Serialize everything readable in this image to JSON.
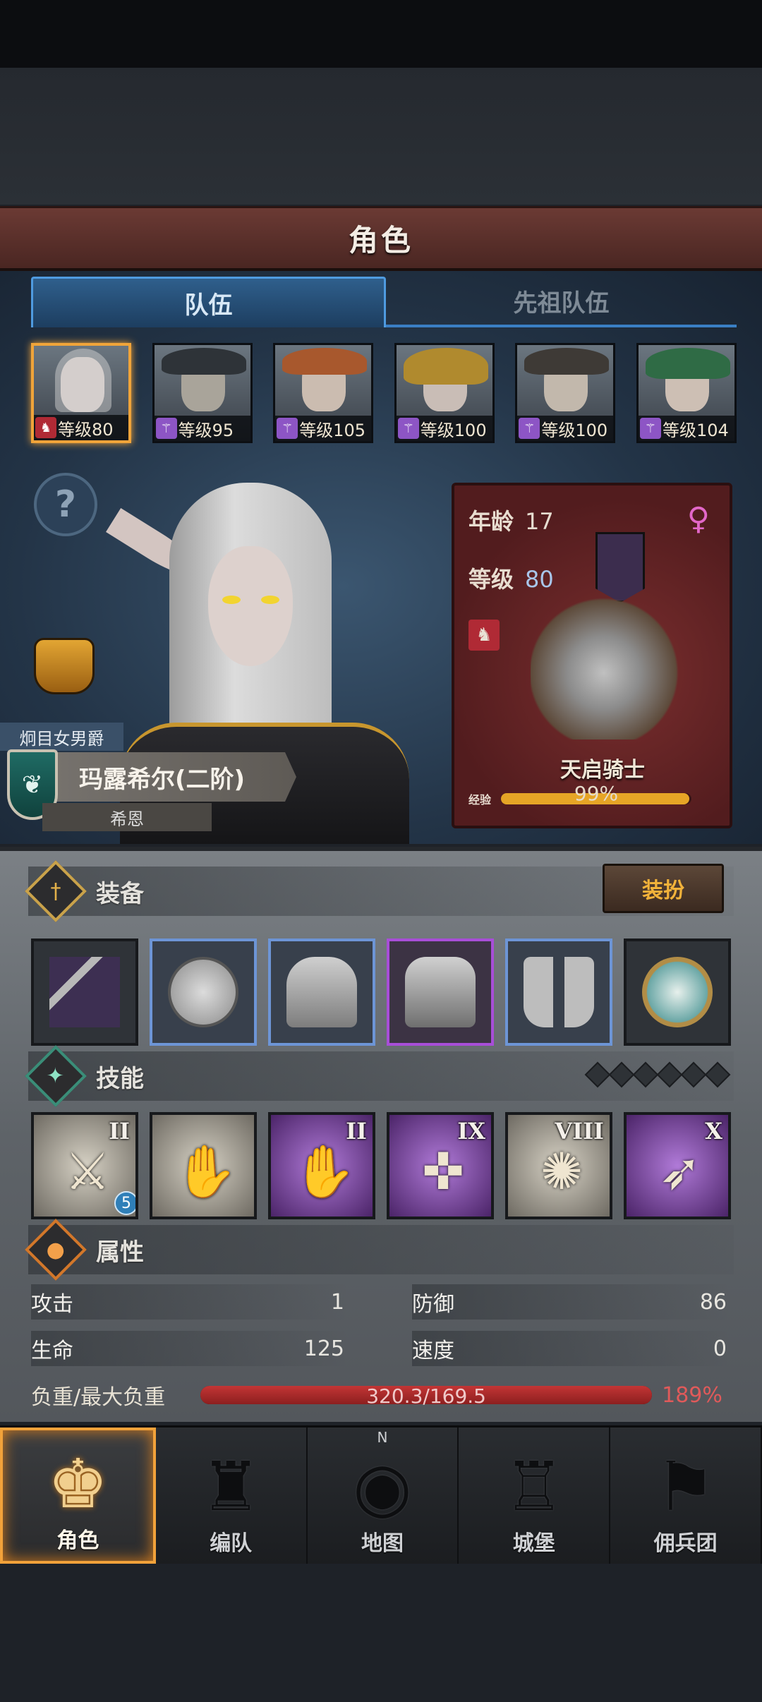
{
  "header": {
    "title": "角色"
  },
  "tabs": [
    {
      "label": "队伍",
      "active": true
    },
    {
      "label": "先祖队伍",
      "active": false
    }
  ],
  "party": [
    {
      "level_text": "等级80",
      "class_icon": "knight-horse-icon",
      "selected": true
    },
    {
      "level_text": "等级95",
      "class_icon": "mage-staff-icon",
      "selected": false
    },
    {
      "level_text": "等级105",
      "class_icon": "mage-staff-icon",
      "selected": false
    },
    {
      "level_text": "等级100",
      "class_icon": "mage-staff-icon",
      "selected": false
    },
    {
      "level_text": "等级100",
      "class_icon": "mage-staff-icon",
      "selected": false
    },
    {
      "level_text": "等级104",
      "class_icon": "mage-staff-icon",
      "selected": false
    }
  ],
  "hero": {
    "title": "炯目女男爵",
    "name": "玛露希尔(二阶)",
    "faction": "希恩",
    "age_label": "年龄",
    "age": "17",
    "level_label": "等级",
    "level": "80",
    "unit_name": "天启骑士",
    "exp_label": "经验",
    "exp_text": "99%",
    "exp_fraction": 0.99,
    "gender_icon": "female-icon"
  },
  "equipment": {
    "title": "装备",
    "dress_button": "装扮",
    "slots": [
      {
        "name": "banner-weapon",
        "rarity": "common"
      },
      {
        "name": "round-shield",
        "rarity": "rare"
      },
      {
        "name": "great-helm",
        "rarity": "rare"
      },
      {
        "name": "plate-armor",
        "rarity": "epic"
      },
      {
        "name": "plate-boots",
        "rarity": "rare"
      },
      {
        "name": "medallion",
        "rarity": "common"
      }
    ]
  },
  "skills": {
    "title": "技能",
    "items": [
      {
        "rank": "II",
        "style": "grey",
        "badge": "5"
      },
      {
        "rank": "",
        "style": "grey",
        "badge": ""
      },
      {
        "rank": "II",
        "style": "purple",
        "badge": ""
      },
      {
        "rank": "IX",
        "style": "purple",
        "badge": ""
      },
      {
        "rank": "VIII",
        "style": "grey",
        "badge": ""
      },
      {
        "rank": "X",
        "style": "purple",
        "badge": ""
      }
    ]
  },
  "attributes": {
    "title": "属性",
    "attack_label": "攻击",
    "attack": "1",
    "defense_label": "防御",
    "defense": "86",
    "hp_label": "生命",
    "hp": "125",
    "speed_label": "速度",
    "speed": "0",
    "load_label": "负重/最大负重",
    "load_text": "320.3/169.5",
    "load_pct": "189%"
  },
  "nav": [
    {
      "label": "角色",
      "icon": "knight-icon",
      "active": true
    },
    {
      "label": "编队",
      "icon": "helmet-group-icon",
      "active": false
    },
    {
      "label": "地图",
      "icon": "compass-map-icon",
      "active": false
    },
    {
      "label": "城堡",
      "icon": "castle-icon",
      "active": false
    },
    {
      "label": "佣兵团",
      "icon": "mercenary-icon",
      "active": false
    }
  ],
  "colors": {
    "accent_orange": "#f2a23a",
    "tab_blue": "#4f9be0",
    "epic_purple": "#a84ed8",
    "rare_blue": "#6d95d6",
    "overload_red": "#e05a5a"
  }
}
